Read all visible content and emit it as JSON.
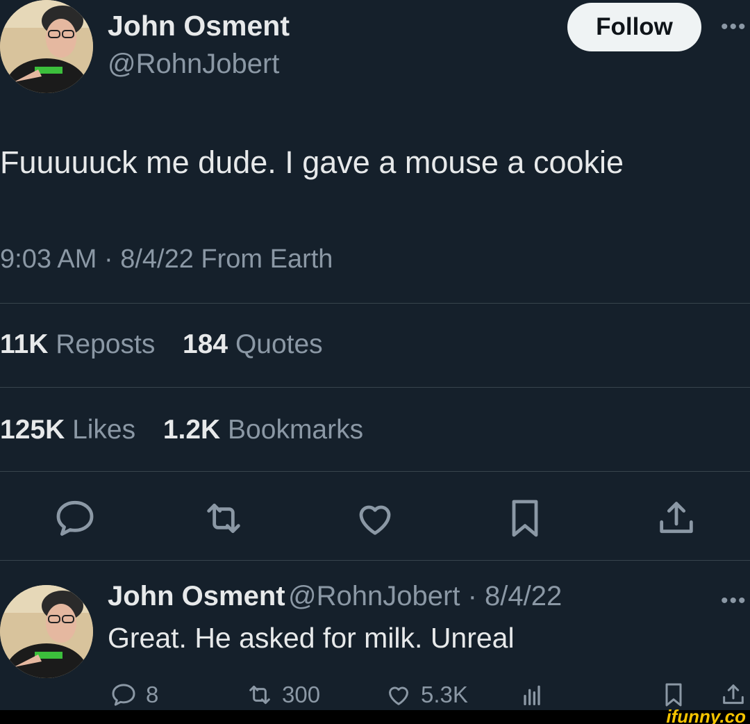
{
  "tweet": {
    "author_name": "John Osment",
    "author_handle": "@RohnJobert",
    "follow_label": "Follow",
    "more_label": "•••",
    "text": "Fuuuuuck me dude. I gave a mouse a cookie",
    "timestamp": "9:03 AM · 8/4/22 From Earth",
    "stats": {
      "reposts_count": "11K",
      "reposts_label": "Reposts",
      "quotes_count": "184",
      "quotes_label": "Quotes",
      "likes_count": "125K",
      "likes_label": "Likes",
      "bookmarks_count": "1.2K",
      "bookmarks_label": "Bookmarks"
    },
    "actions": [
      "reply-icon",
      "repost-icon",
      "like-icon",
      "bookmark-icon",
      "share-icon"
    ]
  },
  "reply": {
    "author_name": "John Osment",
    "meta": "@RohnJobert · 8/4/22",
    "more_label": "•••",
    "text": "Great. He asked for milk. Unreal",
    "replies": "8",
    "reposts": "300",
    "likes": "5.3K"
  },
  "watermark": "ifunny.co",
  "colors": {
    "background": "#15202b",
    "muted": "#8b98a5",
    "text": "#e7e9ea",
    "follow_bg": "#eff3f4"
  }
}
